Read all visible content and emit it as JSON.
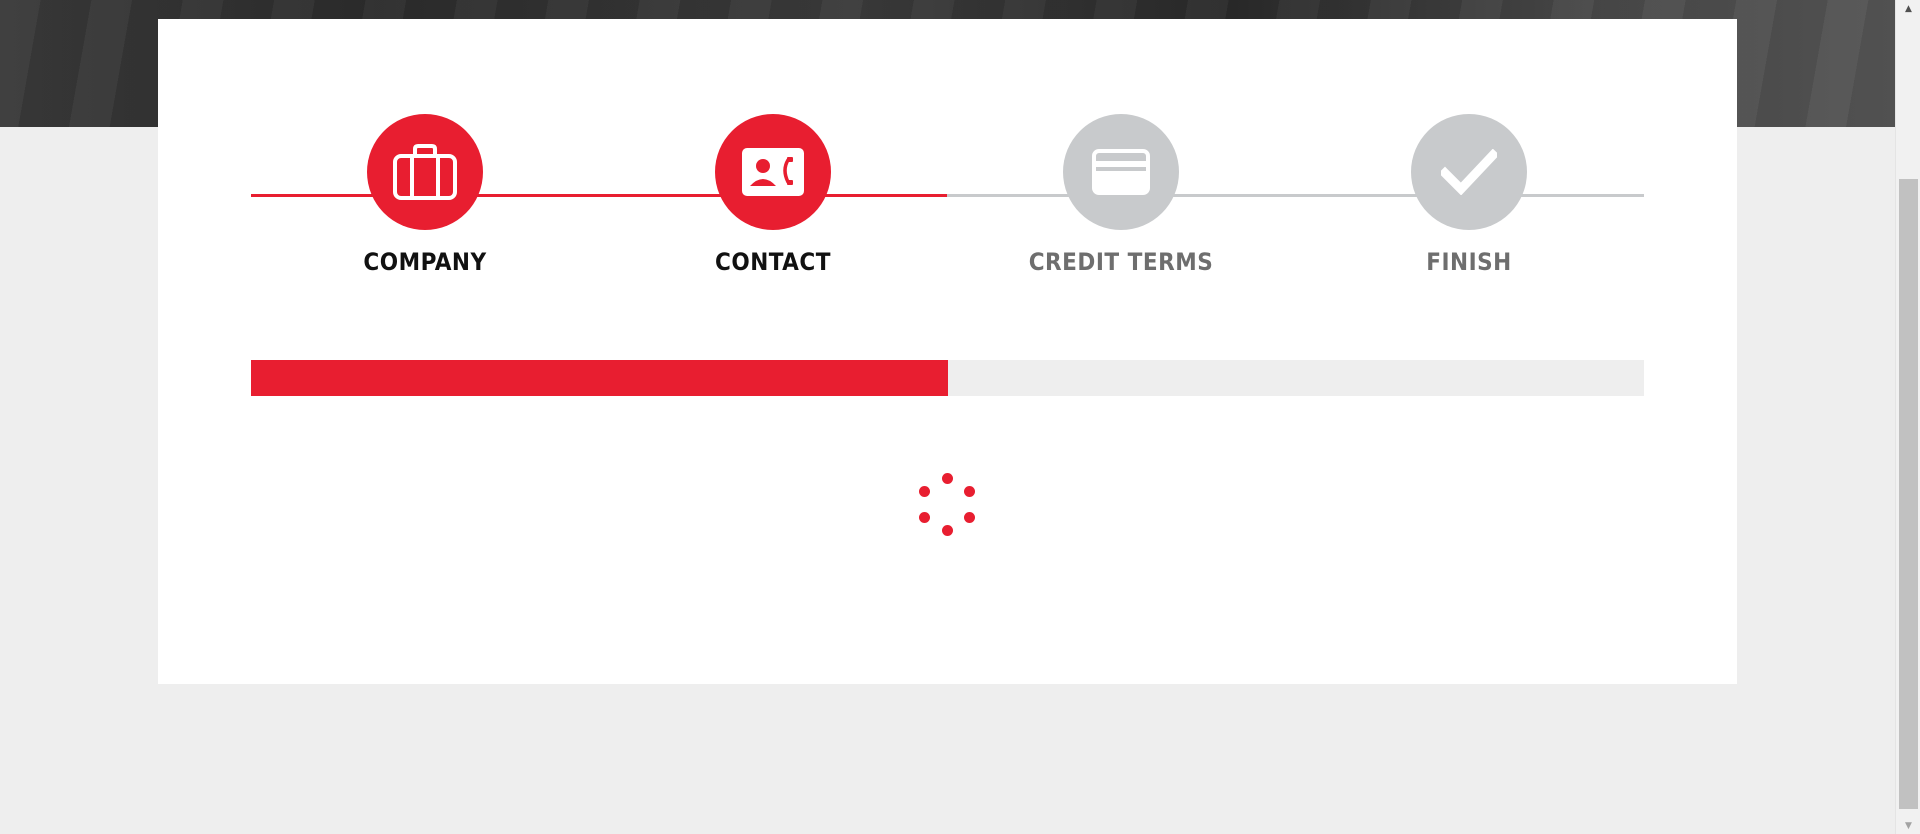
{
  "colors": {
    "accent": "#e81e30",
    "inactive": "#c8cacc",
    "page_background": "#eeeeee",
    "card_background": "#ffffff"
  },
  "steps": [
    {
      "label": "COMPANY",
      "icon": "briefcase-icon",
      "state": "complete"
    },
    {
      "label": "CONTACT",
      "icon": "contact-card-icon",
      "state": "current"
    },
    {
      "label": "CREDIT TERMS",
      "icon": "credit-card-icon",
      "state": "pending"
    },
    {
      "label": "FINISH",
      "icon": "checkmark-icon",
      "state": "pending"
    }
  ],
  "progress": {
    "fraction": 0.5
  },
  "spinner": {
    "icon": "loading-spinner-icon",
    "dot_count": 6
  },
  "scrollbar": {
    "up_icon": "scroll-up-arrow-icon",
    "down_icon": "scroll-down-arrow-icon"
  }
}
